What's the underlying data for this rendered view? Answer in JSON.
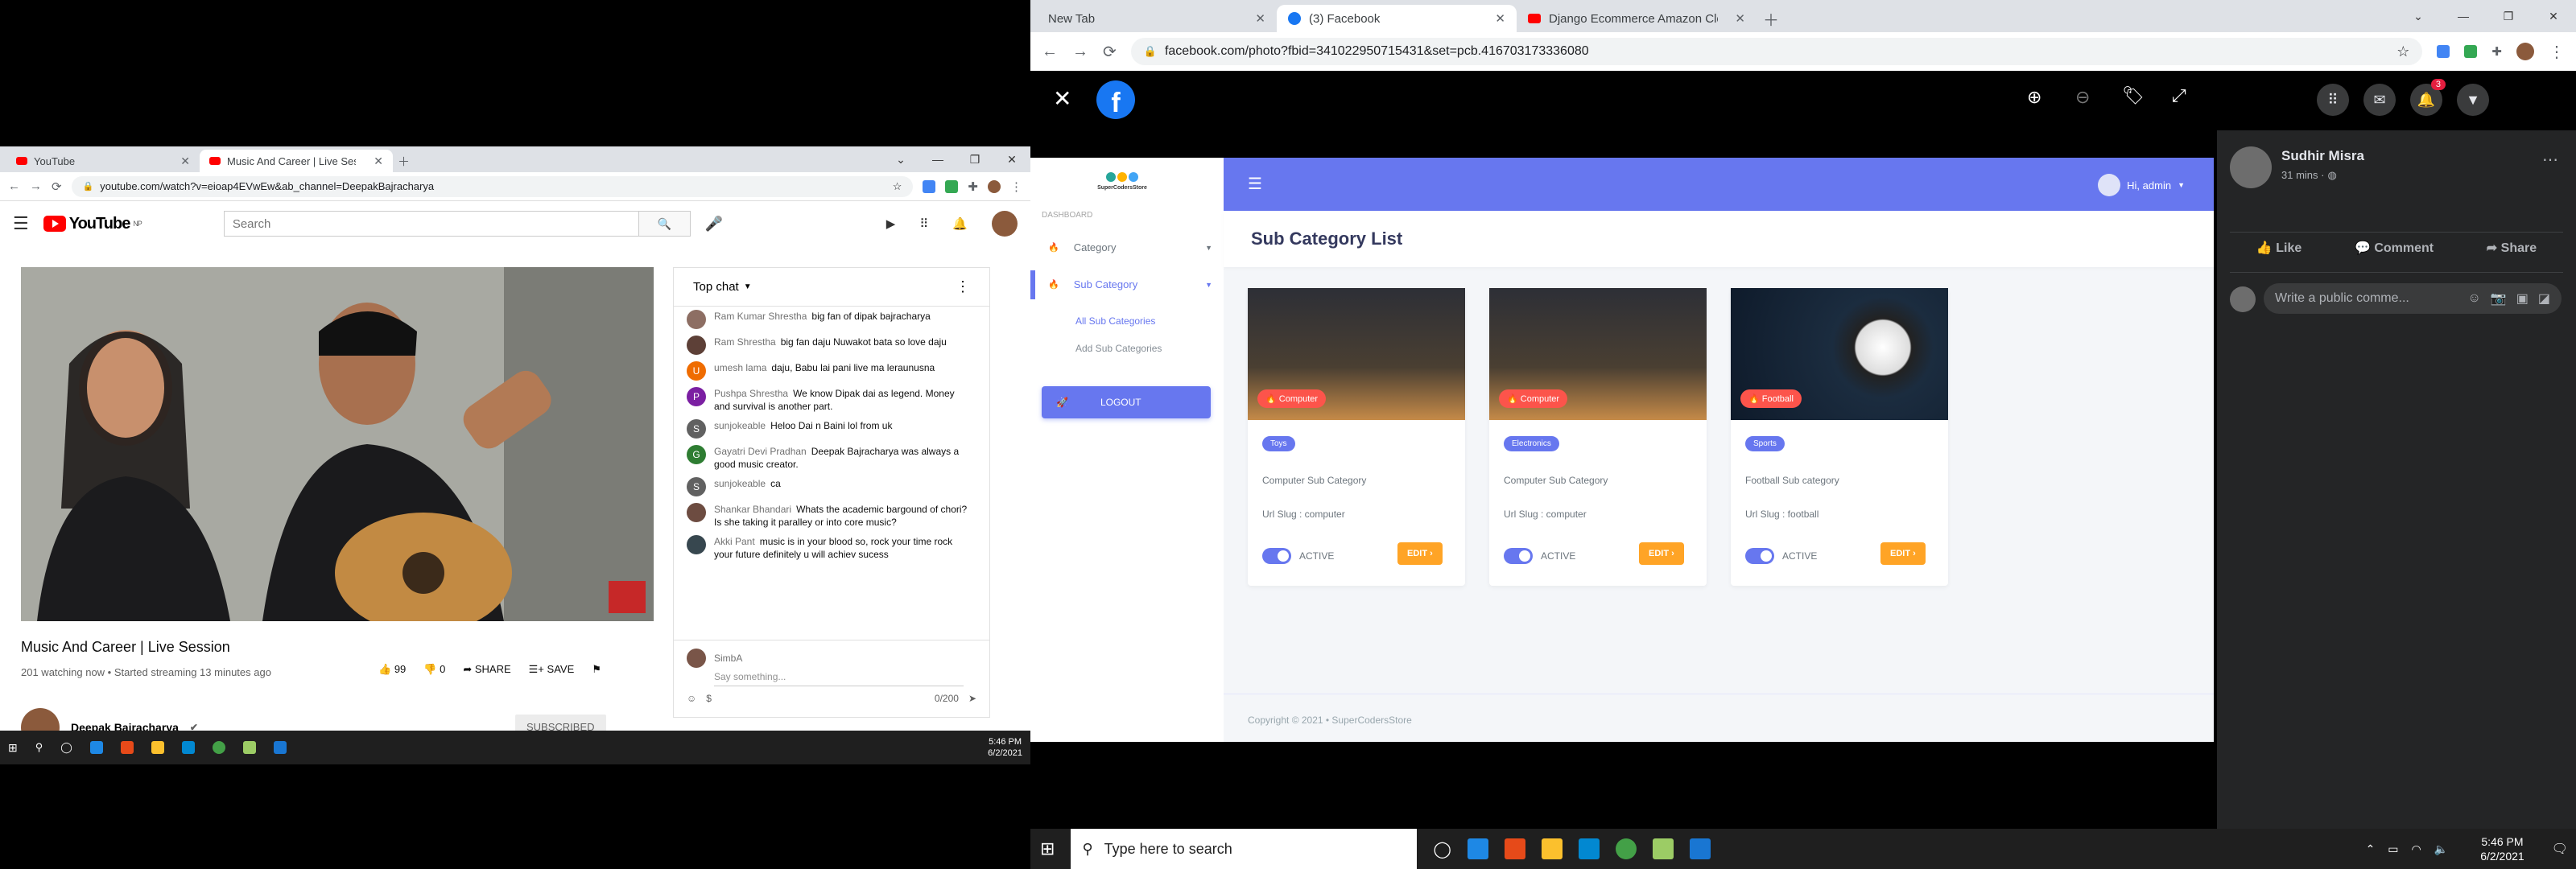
{
  "left_browser": {
    "tabs": [
      {
        "title": "YouTube"
      },
      {
        "title": "Music And Career | Live Sess"
      }
    ],
    "url": "youtube.com/watch?v=eioap4EVwEw&ab_channel=DeepakBajracharya"
  },
  "youtube": {
    "logo_text": "YouTube",
    "logo_region": "NP",
    "search_placeholder": "Search",
    "video_title": "Music And Career | Live Session",
    "watching": "201 watching now • Started streaming 13 minutes ago",
    "likes": "99",
    "dislikes": "0",
    "share_label": "SHARE",
    "save_label": "SAVE",
    "channel_name": "Deepak Bajracharya",
    "subscribed_label": "SUBSCRIBED",
    "chat_header": "Top chat",
    "chat": [
      {
        "author": "Ram Kumar Shrestha",
        "text": "big fan of dipak bajracharya",
        "avatar_color": "#8d6e63",
        "initial": ""
      },
      {
        "author": "Ram Shrestha",
        "text": "big fan daju Nuwakot bata so love daju",
        "avatar_color": "#5d4037",
        "initial": ""
      },
      {
        "author": "umesh lama",
        "text": "daju, Babu lai pani live ma leraunusna",
        "avatar_color": "#ef6c00",
        "initial": "U"
      },
      {
        "author": "Pushpa Shrestha",
        "text": "We know Dipak dai as legend. Money and survival is another part.",
        "avatar_color": "#7b1fa2",
        "initial": "P"
      },
      {
        "author": "sunjokeable",
        "text": "Heloo Dai n Baini lol from uk",
        "avatar_color": "#616161",
        "initial": "S"
      },
      {
        "author": "Gayatri Devi Pradhan",
        "text": "Deepak Bajracharya was always a good music creator.",
        "avatar_color": "#2e7d32",
        "initial": "G"
      },
      {
        "author": "sunjokeable",
        "text": "ca",
        "avatar_color": "#616161",
        "initial": "S"
      },
      {
        "author": "Shankar Bhandari",
        "text": "Whats the academic bargound of chori? Is she taking it paralley or into core music?",
        "avatar_color": "#6d4c41",
        "initial": ""
      },
      {
        "author": "Akki Pant",
        "text": "music is in your blood so, rock your time rock your future definitely u will achiev sucess",
        "avatar_color": "#37474f",
        "initial": ""
      }
    ],
    "chat_user": "SimbA",
    "chat_placeholder": "Say something...",
    "chat_counter": "0/200"
  },
  "left_taskbar": {
    "time": "5:46 PM",
    "date": "6/2/2021"
  },
  "right_browser": {
    "tabs": [
      {
        "title": "New Tab"
      },
      {
        "title": "(3) Facebook"
      },
      {
        "title": "Django Ecommerce Amazon Clo"
      }
    ],
    "url": "facebook.com/photo?fbid=341022950715431&set=pcb.416703173336080"
  },
  "facebook": {
    "poster_name": "Sudhir Misra",
    "post_time": "31 mins ·",
    "like_label": "Like",
    "comment_label": "Comment",
    "share_label": "Share",
    "comment_placeholder": "Write a public comme...",
    "notification_count": "3"
  },
  "dashboard": {
    "brand": "SuperCodersStore",
    "section_label": "DASHBOARD",
    "menu_category": "Category",
    "menu_subcategory": "Sub Category",
    "sub_all": "All Sub Categories",
    "sub_add": "Add Sub Categories",
    "logout": "LOGOUT",
    "greeting": "Hi, admin",
    "page_title": "Sub Category List",
    "footer": "Copyright © 2021  •  SuperCodersStore",
    "cards": [
      {
        "category": "Computer",
        "tag": "Toys",
        "title": "Computer Sub Category",
        "slug": "Url Slug : computer",
        "status": "ACTIVE",
        "edit": "EDIT"
      },
      {
        "category": "Computer",
        "tag": "Electronics",
        "title": "Computer Sub Category",
        "slug": "Url Slug : computer",
        "status": "ACTIVE",
        "edit": "EDIT"
      },
      {
        "category": "Football",
        "tag": "Sports",
        "title": "Football Sub category",
        "slug": "Url Slug : football",
        "status": "ACTIVE",
        "edit": "EDIT"
      }
    ]
  },
  "right_taskbar": {
    "search_placeholder": "Type here to search",
    "time": "5:46 PM",
    "date": "6/2/2021"
  }
}
